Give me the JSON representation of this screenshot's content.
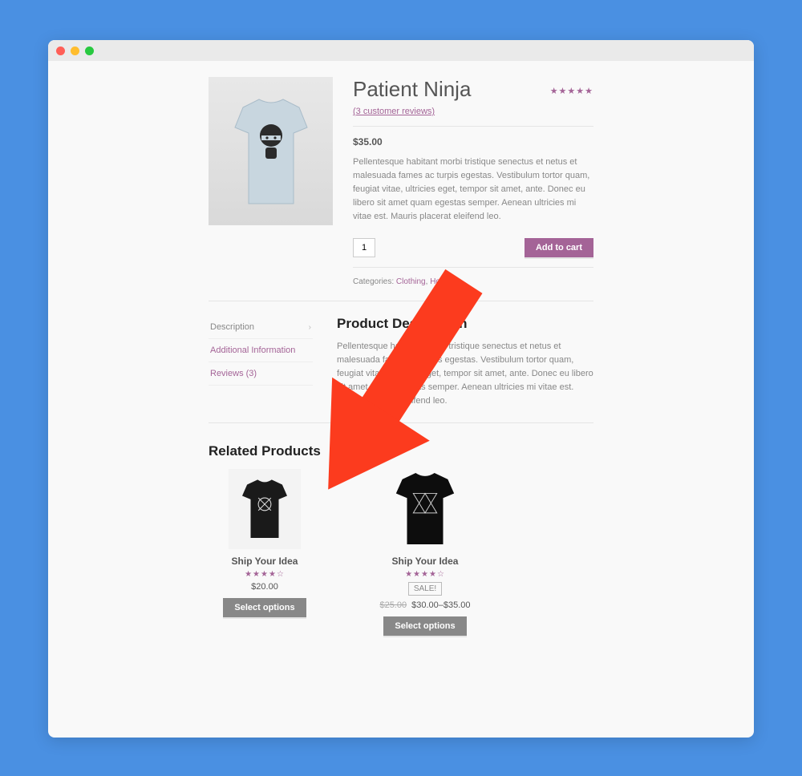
{
  "product": {
    "title": "Patient Ninja",
    "reviews_link": "(3 customer reviews)",
    "rating_stars": "★★★★★",
    "price": "$35.00",
    "description": "Pellentesque habitant morbi tristique senectus et netus et malesuada fames ac turpis egestas. Vestibulum tortor quam, feugiat vitae, ultricies eget, tempor sit amet, ante. Donec eu libero sit amet quam egestas semper. Aenean ultricies mi vitae est. Mauris placerat eleifend leo.",
    "qty_value": "1",
    "add_to_cart": "Add to cart",
    "categories_label": "Categories: ",
    "category1": "Clothing",
    "cat_sep": ", ",
    "category2": "Hoodies",
    "cat_end": "."
  },
  "tabs": {
    "description": "Description",
    "additional": "Additional Information",
    "reviews": "Reviews (3)",
    "content_heading": "Product Description",
    "content_body": "Pellentesque habitant morbi tristique senectus et netus et malesuada fames ac turpis egestas. Vestibulum tortor quam, feugiat vitae, ultricies eget, tempor sit amet, ante. Donec eu libero sit amet quam egestas semper. Aenean ultricies mi vitae est. Mauris placerat eleifend leo."
  },
  "related": {
    "heading": "Related Products",
    "items": [
      {
        "name": "Ship Your Idea",
        "stars": "★★★★☆",
        "price": "$20.00",
        "button": "Select options",
        "sale": false
      },
      {
        "name": "Ship Your Idea",
        "stars": "★★★★☆",
        "sale_label": "SALE!",
        "old_price": "$25.00",
        "price": "$30.00–$35.00",
        "button": "Select options",
        "sale": true
      }
    ]
  }
}
